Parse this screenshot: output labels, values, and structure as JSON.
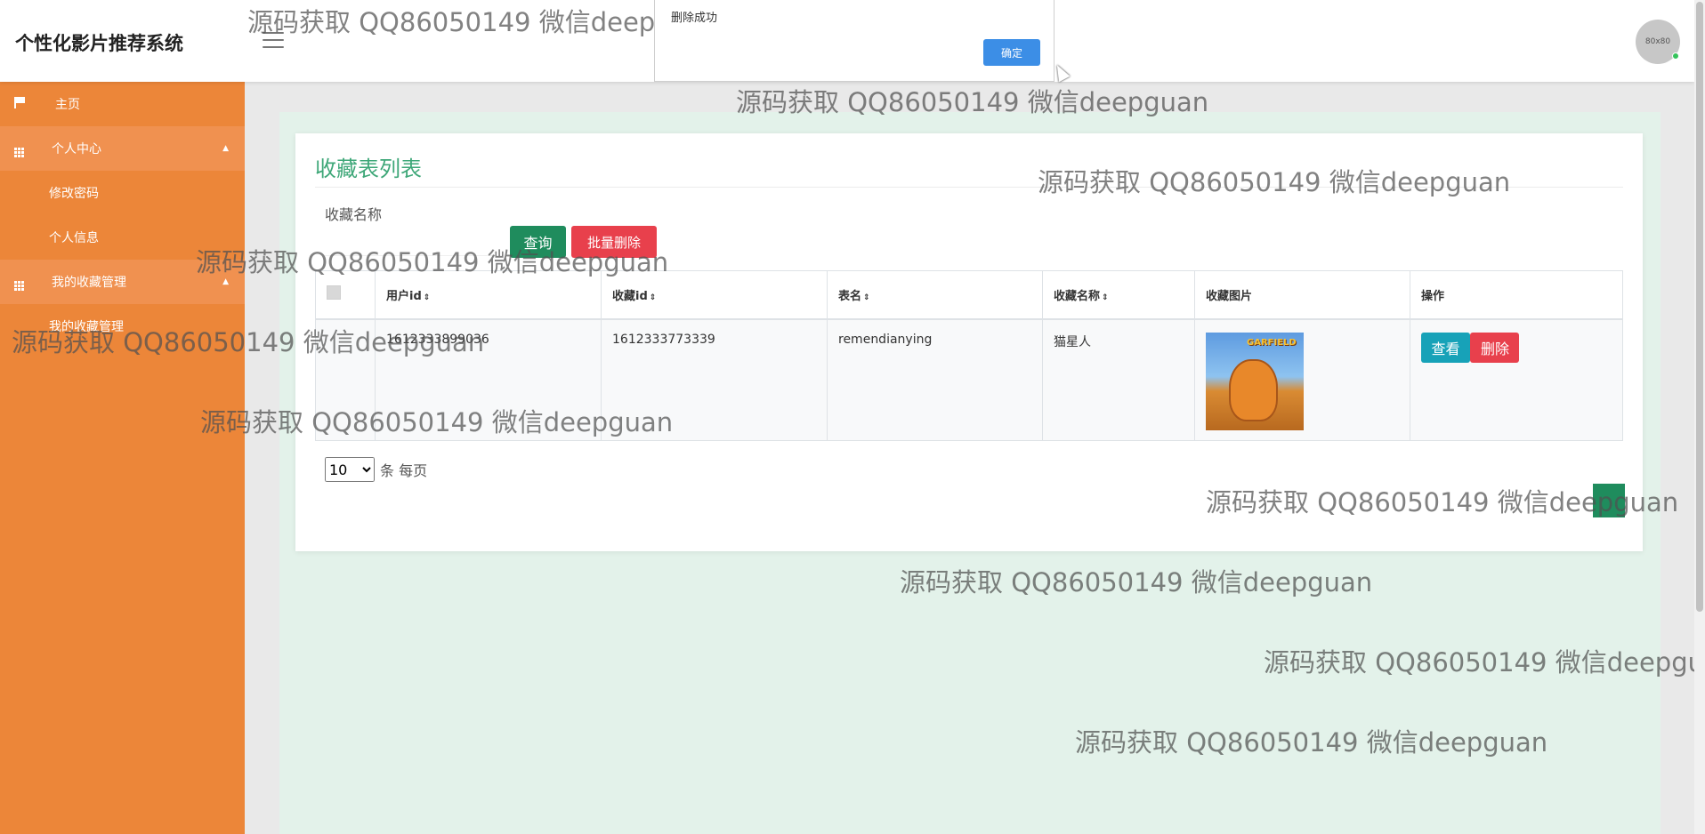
{
  "header": {
    "title": "个性化影片推荐系统",
    "avatar_text": "80x80"
  },
  "dialog": {
    "message": "删除成功",
    "confirm_label": "确定"
  },
  "sidebar": {
    "home": "主页",
    "personal_center": "个人中心",
    "change_password": "修改密码",
    "personal_info": "个人信息",
    "favorites_management": "我的收藏管理",
    "favorites_sub": "我的收藏管理"
  },
  "panel": {
    "title": "收藏表列表",
    "search_label": "收藏名称",
    "search_value": "",
    "search_button": "查询",
    "batch_delete_button": "批量删除"
  },
  "table": {
    "headers": [
      "用户id",
      "收藏id",
      "表名",
      "收藏名称",
      "收藏图片",
      "操作"
    ],
    "rows": [
      {
        "user_id": "1612333899036",
        "fav_id": "1612333773339",
        "table_name": "remendianying",
        "fav_name": "猫星人",
        "image_caption": "GARFIELD",
        "view_label": "查看",
        "delete_label": "删除"
      }
    ]
  },
  "pagination": {
    "page_size": "10",
    "page_size_options": [
      "10"
    ],
    "per_page_label": "条 每页"
  },
  "watermark": "源码获取 QQ86050149 微信deepguan",
  "colors": {
    "sidebar": "#ec8639",
    "title_green": "#3ea778",
    "search_btn": "#1f8c5d",
    "danger": "#e8404c",
    "info": "#17a2b8",
    "content_bg": "#e3f2ea"
  }
}
